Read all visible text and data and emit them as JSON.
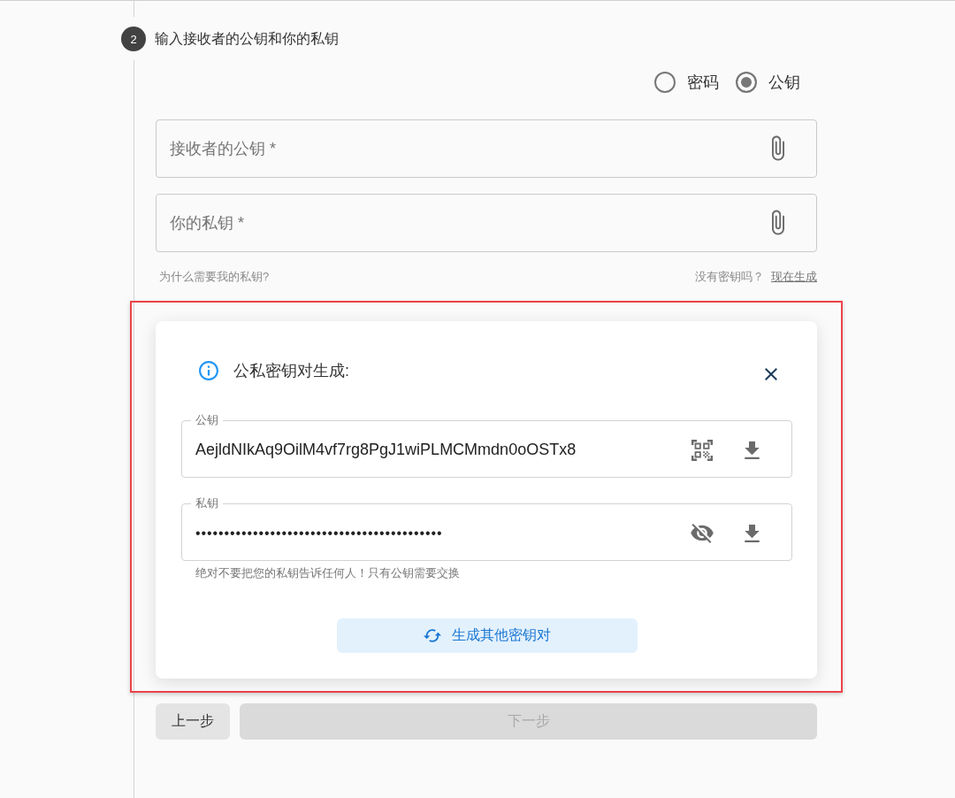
{
  "step": {
    "number": "2",
    "title": "输入接收者的公钥和你的私钥"
  },
  "mode_options": [
    {
      "label": "密码",
      "selected": false
    },
    {
      "label": "公钥",
      "selected": true
    }
  ],
  "fields": [
    {
      "placeholder": "接收者的公钥 *"
    },
    {
      "placeholder": "你的私钥 *"
    }
  ],
  "help_row": {
    "question": "为什么需要我的私钥?",
    "prompt": "没有密钥吗？",
    "generate_link": "现在生成"
  },
  "keypair_panel": {
    "title": "公私密钥对生成:",
    "public_key": {
      "label": "公钥",
      "value": "AejldNIkAq9OilM4vf7rg8PgJ1wiPLMCMmdn0oOSTx8"
    },
    "private_key": {
      "label": "私钥",
      "value": "•••••••••••••••••••••••••••••••••••••••••••",
      "revealed": false,
      "hint": "绝对不要把您的私钥告诉任何人！只有公钥需要交换"
    },
    "regenerate_button": "生成其他密钥对"
  },
  "nav_buttons": [
    {
      "label": "上一步",
      "disabled": false
    },
    {
      "label": "下一步",
      "disabled": true
    }
  ]
}
